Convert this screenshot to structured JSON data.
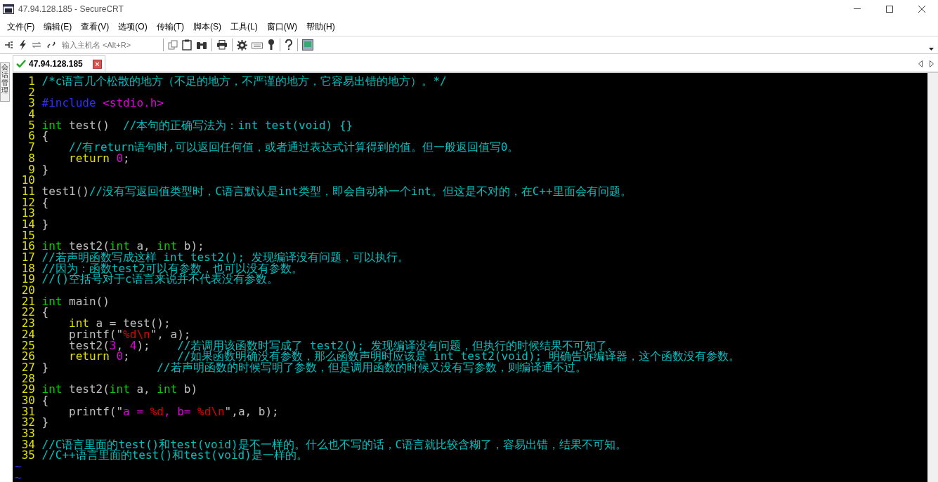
{
  "window": {
    "title": "47.94.128.185 - SecureCRT"
  },
  "menu": [
    "文件(F)",
    "编辑(E)",
    "查看(V)",
    "选项(O)",
    "传输(T)",
    "脚本(S)",
    "工具(L)",
    "窗口(W)",
    "帮助(H)"
  ],
  "toolbar": {
    "quick_connect": {
      "placeholder": "输入主机名 <Alt+R>"
    }
  },
  "side_panel": {
    "label": "会话管理"
  },
  "tabs": [
    {
      "label": "47.94.128.185",
      "selected": true,
      "connected": true
    }
  ],
  "terminal": {
    "lines": [
      {
        "number": "1",
        "tokens": [
          {
            "kind": "comment",
            "text": "/*c语言几个松散的地方（不足的地方，不严谨的地方，它容易出错的地方）。*/"
          }
        ]
      },
      {
        "number": "2"
      },
      {
        "number": "3",
        "tokens": [
          {
            "kind": "preproc",
            "text": "#include"
          },
          {
            "kind": "header",
            "text": " <stdio.h>"
          }
        ]
      },
      {
        "number": "4"
      },
      {
        "number": "5",
        "tokens": [
          {
            "kind": "keyword",
            "text": "int"
          },
          {
            "kind": "plain",
            "text": " test()  "
          },
          {
            "kind": "comment",
            "text": "//本句的正确写法为：int test(void) {}"
          }
        ]
      },
      {
        "number": "6",
        "tokens": [
          {
            "kind": "plain",
            "text": "{"
          }
        ]
      },
      {
        "number": "7",
        "tokens": [
          {
            "kind": "comment",
            "text": "    //有return语句时,可以返回任何值，或者通过表达式计算得到的值。但一般返回值写0。"
          }
        ]
      },
      {
        "number": "8",
        "tokens": [
          {
            "kind": "keyword2",
            "text": "    return"
          },
          {
            "kind": "number",
            "text": " 0"
          },
          {
            "kind": "plain",
            "text": ";"
          }
        ]
      },
      {
        "number": "9",
        "tokens": [
          {
            "kind": "plain",
            "text": "}"
          }
        ]
      },
      {
        "number": "10"
      },
      {
        "number": "11",
        "tokens": [
          {
            "kind": "plain",
            "text": "test1()"
          },
          {
            "kind": "comment",
            "text": "//没有写返回值类型时，C语言默认是int类型，即会自动补一个int。但这是不对的，在C++里面会有问题。"
          }
        ]
      },
      {
        "number": "12",
        "tokens": [
          {
            "kind": "plain",
            "text": "{"
          }
        ]
      },
      {
        "number": "13"
      },
      {
        "number": "14",
        "tokens": [
          {
            "kind": "plain",
            "text": "}"
          }
        ]
      },
      {
        "number": "15"
      },
      {
        "number": "16",
        "tokens": [
          {
            "kind": "keyword",
            "text": "int"
          },
          {
            "kind": "plain",
            "text": " test2("
          },
          {
            "kind": "keyword",
            "text": "int"
          },
          {
            "kind": "plain",
            "text": " a, "
          },
          {
            "kind": "keyword",
            "text": "int"
          },
          {
            "kind": "plain",
            "text": " b);"
          }
        ]
      },
      {
        "number": "17",
        "tokens": [
          {
            "kind": "comment",
            "text": "//若声明函数写成这样 int test2(); 发现编译没有问题，可以执行。"
          }
        ]
      },
      {
        "number": "18",
        "tokens": [
          {
            "kind": "comment",
            "text": "//因为：函数test2可以有参数，也可以没有参数。"
          }
        ]
      },
      {
        "number": "19",
        "tokens": [
          {
            "kind": "comment",
            "text": "//()空括号对于c语言来说并不代表没有参数。"
          }
        ]
      },
      {
        "number": "20"
      },
      {
        "number": "21",
        "tokens": [
          {
            "kind": "keyword",
            "text": "int"
          },
          {
            "kind": "plain",
            "text": " main()"
          }
        ]
      },
      {
        "number": "22",
        "tokens": [
          {
            "kind": "plain",
            "text": "{"
          }
        ]
      },
      {
        "number": "23",
        "tokens": [
          {
            "kind": "keyword2",
            "text": "    int"
          },
          {
            "kind": "plain",
            "text": " a = test();"
          }
        ]
      },
      {
        "number": "24",
        "tokens": [
          {
            "kind": "plain",
            "text": "    printf(\""
          },
          {
            "kind": "escape",
            "text": "%d\\n"
          },
          {
            "kind": "plain",
            "text": "\", a);"
          }
        ]
      },
      {
        "number": "25",
        "tokens": [
          {
            "kind": "plain",
            "text": "    test2("
          },
          {
            "kind": "number",
            "text": "3"
          },
          {
            "kind": "plain",
            "text": ", "
          },
          {
            "kind": "number",
            "text": "4"
          },
          {
            "kind": "plain",
            "text": ");    "
          },
          {
            "kind": "comment",
            "text": "//若调用该函数时写成了 test2(); 发现编译没有问题，但执行的时候结果不可知了。"
          }
        ]
      },
      {
        "number": "26",
        "tokens": [
          {
            "kind": "keyword2",
            "text": "    return"
          },
          {
            "kind": "number",
            "text": " 0"
          },
          {
            "kind": "plain",
            "text": ";       "
          },
          {
            "kind": "comment",
            "text": "//如果函数明确没有参数，那么函数声明时应该是 int test2(void); 明确告诉编译器，这个函数没有参数。"
          }
        ]
      },
      {
        "number": "27",
        "tokens": [
          {
            "kind": "plain",
            "text": "}                "
          },
          {
            "kind": "comment",
            "text": "//若声明函数的时候写明了参数，但是调用函数的时候又没有写参数，则编译通不过。"
          }
        ]
      },
      {
        "number": "28"
      },
      {
        "number": "29",
        "tokens": [
          {
            "kind": "keyword",
            "text": "int"
          },
          {
            "kind": "plain",
            "text": " test2("
          },
          {
            "kind": "keyword",
            "text": "int"
          },
          {
            "kind": "plain",
            "text": " a, "
          },
          {
            "kind": "keyword",
            "text": "int"
          },
          {
            "kind": "plain",
            "text": " b)"
          }
        ]
      },
      {
        "number": "30",
        "tokens": [
          {
            "kind": "plain",
            "text": "{"
          }
        ]
      },
      {
        "number": "31",
        "tokens": [
          {
            "kind": "plain",
            "text": "    printf(\""
          },
          {
            "kind": "string",
            "text": "a = "
          },
          {
            "kind": "escape",
            "text": "%d"
          },
          {
            "kind": "string",
            "text": ", b= "
          },
          {
            "kind": "escape",
            "text": "%d\\n"
          },
          {
            "kind": "plain",
            "text": "\",a, b);"
          }
        ]
      },
      {
        "number": "32",
        "tokens": [
          {
            "kind": "plain",
            "text": "}"
          }
        ]
      },
      {
        "number": "33"
      },
      {
        "number": "34",
        "tokens": [
          {
            "kind": "comment",
            "text": "//C语言里面的test()和test(void)是不一样的。什么也不写的话，C语言就比较含糊了，容易出错，结果不可知。"
          }
        ]
      },
      {
        "number": "35",
        "tokens": [
          {
            "kind": "comment",
            "text": "//C++语言里面的test()和test(void)是一样的。"
          }
        ]
      }
    ],
    "filler": [
      "~",
      "~"
    ]
  }
}
